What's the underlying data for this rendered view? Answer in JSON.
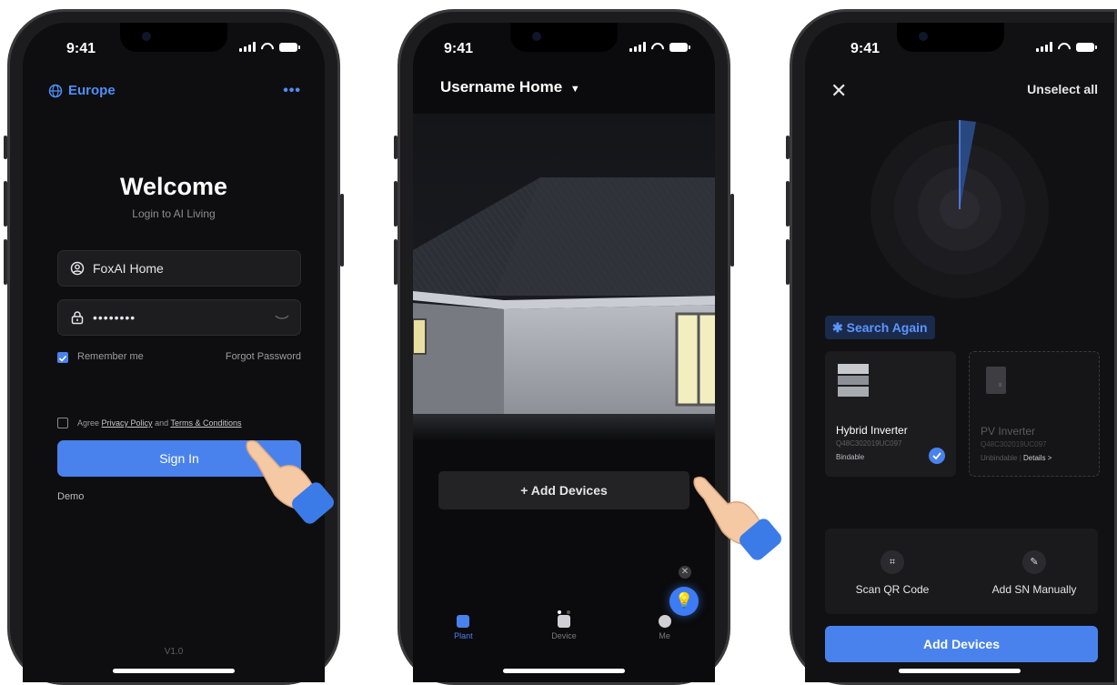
{
  "status": {
    "time": "9:41"
  },
  "login": {
    "region": "Europe",
    "more": "•••",
    "title": "Welcome",
    "subtitle": "Login to AI Living",
    "username_value": "FoxAI Home",
    "password_value": "••••••••",
    "remember_label": "Remember me",
    "forgot_label": "Forgot Password",
    "agree_prefix": "Agree",
    "privacy_link": "Privacy Policy",
    "agree_and": "and",
    "terms_link": "Terms & Conditions",
    "signin_label": "Sign In",
    "demo_label": "Demo",
    "version": "V1.0"
  },
  "home": {
    "home_name": "Username Home",
    "add_devices_label": "+ Add Devices",
    "tabs": [
      {
        "label": "Plant",
        "active": true
      },
      {
        "label": "Device",
        "active": false
      },
      {
        "label": "Me",
        "active": false
      }
    ]
  },
  "scan": {
    "unselect_label": "Unselect all",
    "search_again_label": "Search Again",
    "devices": [
      {
        "name": "Hybrid Inverter",
        "sn": "Q48C302019UC097",
        "status": "Bindable",
        "selected": true
      },
      {
        "name": "PV Inverter",
        "sn": "Q48C302019UC097",
        "status": "Unbindable",
        "details": "Details >",
        "selected": false
      }
    ],
    "scan_qr_label": "Scan QR Code",
    "add_sn_label": "Add SN Manually",
    "add_devices_label": "Add Devices"
  },
  "colors": {
    "accent": "#4a82ed",
    "background": "#0e0e10",
    "link": "#4f8ef7"
  }
}
